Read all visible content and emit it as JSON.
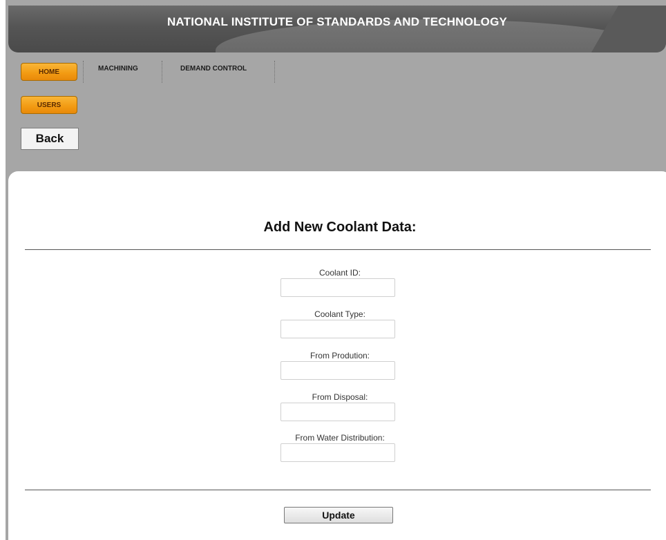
{
  "header": {
    "title": "NATIONAL INSTITUTE OF STANDARDS AND TECHNOLOGY"
  },
  "nav": {
    "home_label": "HOME",
    "users_label": "USERS",
    "machining_label": "MACHINING",
    "demand_control_label": "DEMAND CONTROL",
    "back_label": "Back"
  },
  "form": {
    "title": "Add New Coolant Data:",
    "fields": [
      {
        "label": "Coolant ID:",
        "value": ""
      },
      {
        "label": "Coolant Type:",
        "value": ""
      },
      {
        "label": "From Prodution:",
        "value": ""
      },
      {
        "label": "From Disposal:",
        "value": ""
      },
      {
        "label": "From Water Distribution:",
        "value": ""
      }
    ],
    "submit_label": "Update"
  },
  "colors": {
    "nav_button": "#f29a12",
    "page_background": "#a6a6a6",
    "banner": "#555555"
  }
}
